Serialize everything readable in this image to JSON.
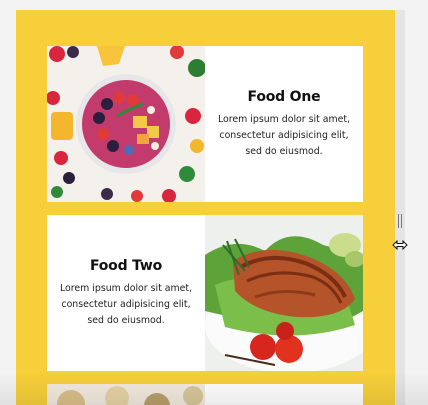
{
  "cards": [
    {
      "title": "Food One",
      "body": "Lorem ipsum dolor sit amet, consectetur adipisicing elit, sed do eiusmod.",
      "image": "fruit-smoothie-bowl"
    },
    {
      "title": "Food Two",
      "body": "Lorem ipsum dolor sit amet, consectetur adipisicing elit, sed do eiusmod.",
      "image": "grilled-salmon-salad"
    },
    {
      "title": "",
      "body": "",
      "image": "partial-food-photo"
    }
  ],
  "colors": {
    "page_background": "#f6cf3a",
    "card_background": "#ffffff",
    "text": "#111111"
  },
  "cursor": "horizontal-resize-cursor"
}
